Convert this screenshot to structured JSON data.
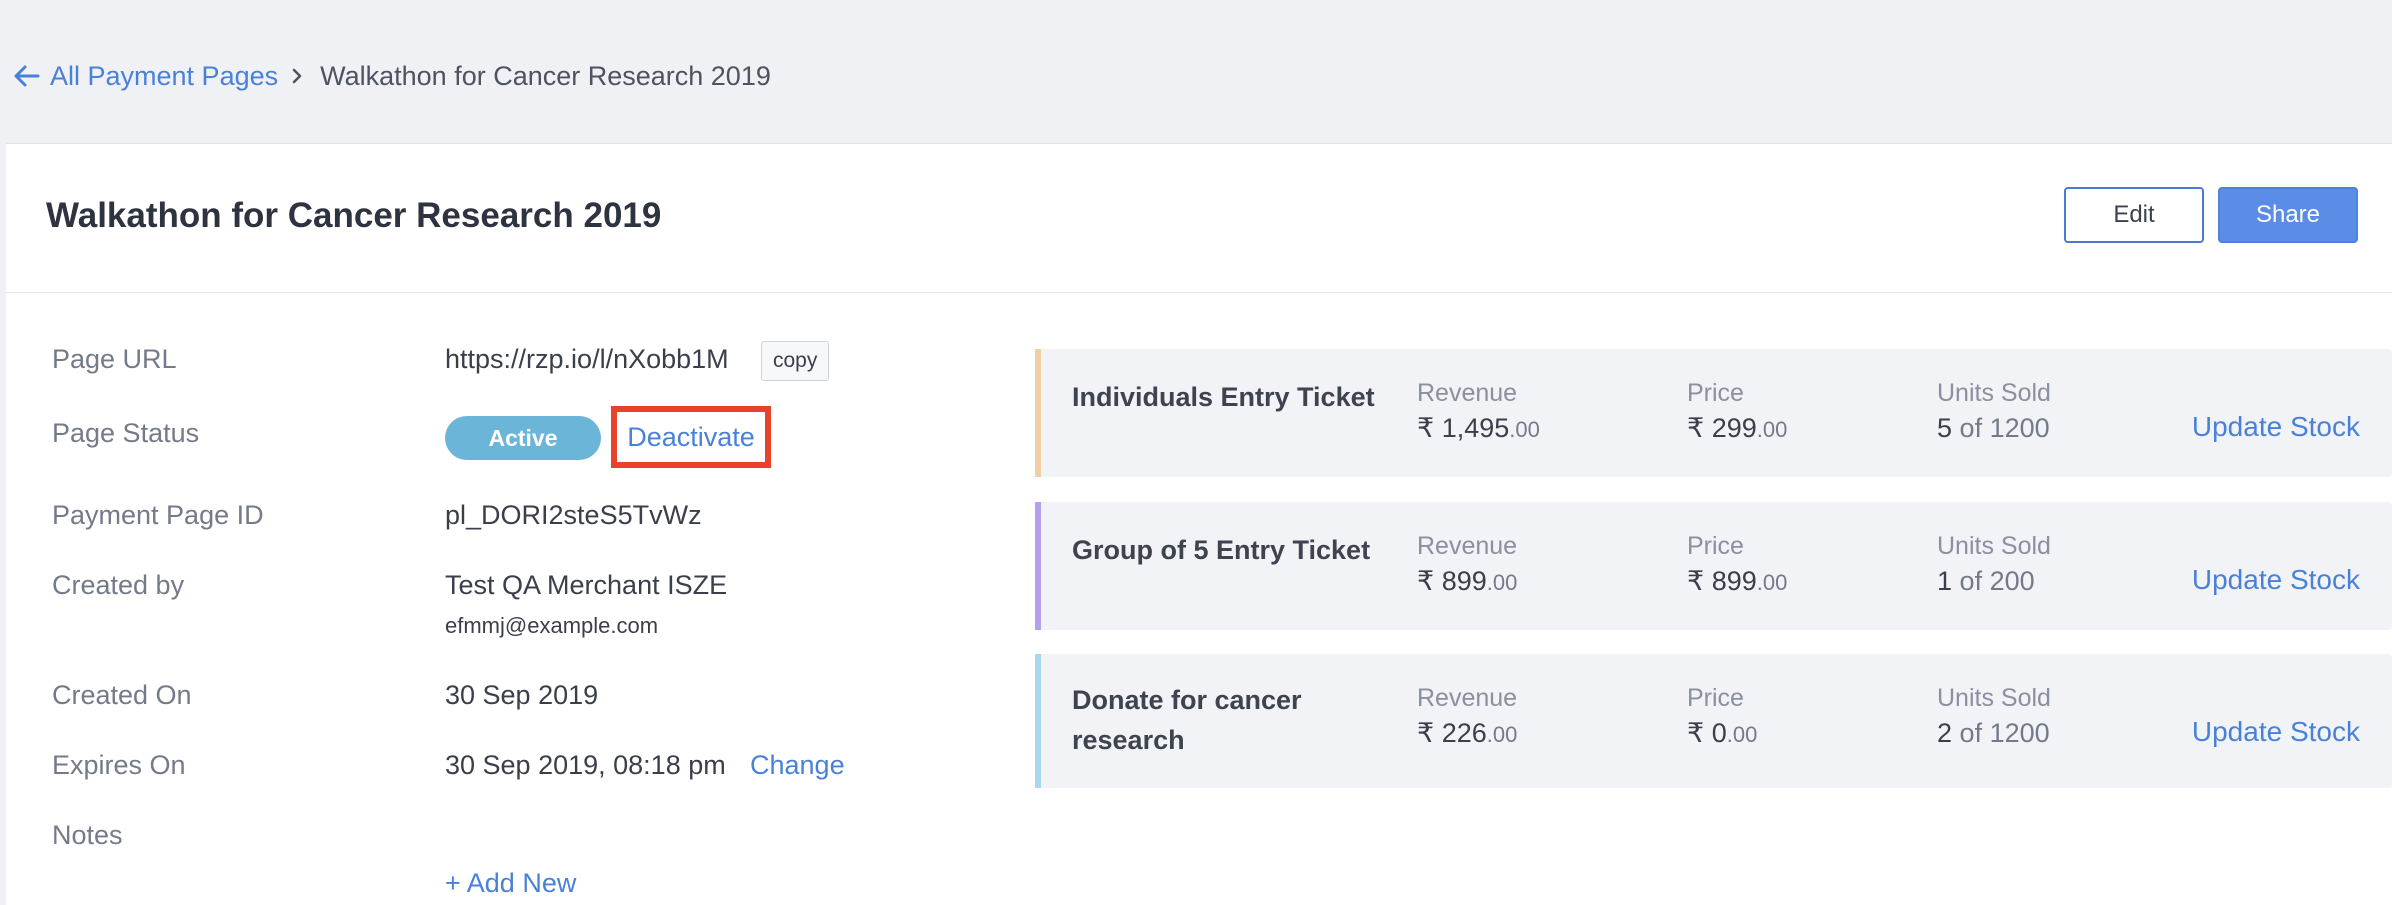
{
  "breadcrumb": {
    "back_label": "All Payment Pages",
    "current": "Walkathon for Cancer Research 2019"
  },
  "header": {
    "title": "Walkathon for Cancer Research 2019",
    "edit_label": "Edit",
    "share_label": "Share"
  },
  "details": {
    "page_url_label": "Page URL",
    "page_url": "https://rzp.io/l/nXobb1M",
    "copy_label": "copy",
    "status_label": "Page Status",
    "status": "Active",
    "deactivate_label": "Deactivate",
    "page_id_label": "Payment Page ID",
    "page_id": "pl_DORI2steS5TvWz",
    "created_by_label": "Created by",
    "created_by": "Test QA Merchant ISZE",
    "created_by_email": "efmmj@example.com",
    "created_on_label": "Created On",
    "created_on": "30 Sep 2019",
    "expires_on_label": "Expires On",
    "expires_on": "30 Sep 2019, 08:18 pm",
    "change_label": "Change",
    "notes_label": "Notes",
    "add_new_label": "+ Add New"
  },
  "items": [
    {
      "name": "Individuals Entry Ticket",
      "accent": "#f2cfa6",
      "revenue_label": "Revenue",
      "revenue_symbol": "₹",
      "revenue_int": "1,495",
      "revenue_dec": ".00",
      "price_label": "Price",
      "price_symbol": "₹",
      "price_int": "299",
      "price_dec": ".00",
      "units_label": "Units Sold",
      "units_sold": "5",
      "units_total": "of 1200",
      "action_label": "Update Stock"
    },
    {
      "name": "Group of 5 Entry Ticket",
      "accent": "#b7a0ea",
      "revenue_label": "Revenue",
      "revenue_symbol": "₹",
      "revenue_int": "899",
      "revenue_dec": ".00",
      "price_label": "Price",
      "price_symbol": "₹",
      "price_int": "899",
      "price_dec": ".00",
      "units_label": "Units Sold",
      "units_sold": "1",
      "units_total": "of 200",
      "action_label": "Update Stock"
    },
    {
      "name": "Donate for cancer research",
      "accent": "#a9d7ef",
      "revenue_label": "Revenue",
      "revenue_symbol": "₹",
      "revenue_int": "226",
      "revenue_dec": ".00",
      "price_label": "Price",
      "price_symbol": "₹",
      "price_int": "0",
      "price_dec": ".00",
      "units_label": "Units Sold",
      "units_sold": "2",
      "units_total": "of 1200",
      "action_label": "Update Stock"
    }
  ],
  "colors": {
    "link": "#4a81d8",
    "primary_button": "#5b8ce6",
    "status_active": "#6bb5d9",
    "highlight_box": "#e8412c"
  }
}
